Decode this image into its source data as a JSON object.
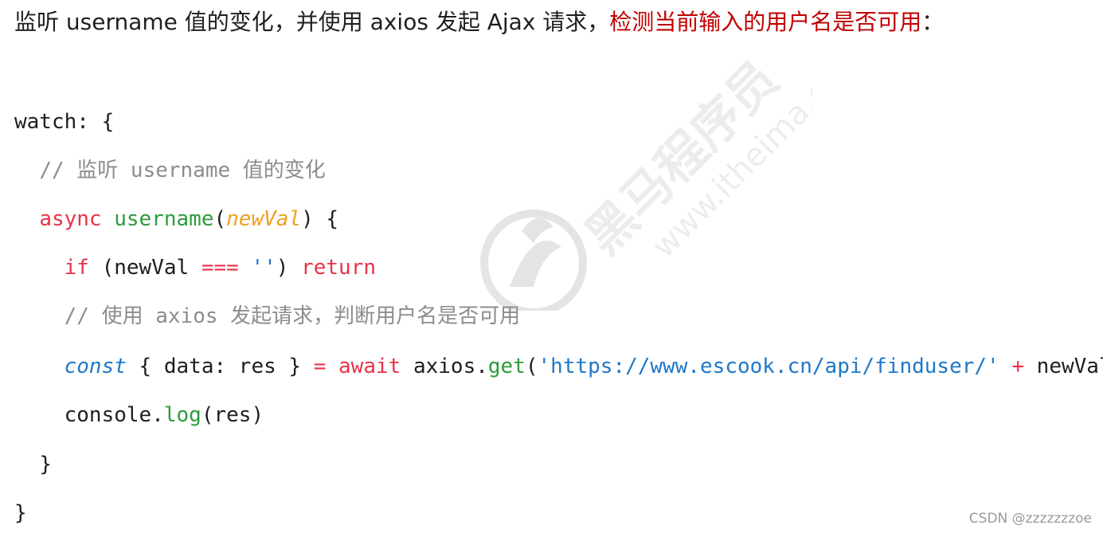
{
  "intro": {
    "normal": "监听 username 值的变化，并使用 axios 发起 Ajax 请求，",
    "highlight": "检测当前输入的用户名是否可用",
    "colon": "："
  },
  "code": {
    "l1": "watch: {",
    "l2_comment": "// 监听 username 值的变化",
    "l3_async": "async",
    "l3_fn": "username",
    "l3_open": "(",
    "l3_param": "newVal",
    "l3_close": ") {",
    "l4_if": "if",
    "l4_mid": " (newVal ",
    "l4_eq": "===",
    "l4_str": "''",
    "l4_paren": ") ",
    "l4_return": "return",
    "l5_comment": "// 使用 axios 发起请求，判断用户名是否可用",
    "l6_const": "const",
    "l6_mid": " { data: res } ",
    "l6_eq": "=",
    "l6_await": "await",
    "l6_axios": " axios.",
    "l6_get": "get",
    "l6_open": "(",
    "l6_str": "'https://www.escook.cn/api/finduser/'",
    "l6_plus": "+",
    "l6_tail": " newVal)",
    "l7_console": "console.",
    "l7_log": "log",
    "l7_tail": "(res)",
    "l8": "}",
    "l9": "}"
  },
  "watermark": {
    "brand": "黑马程序员",
    "url": "www.itheima.com"
  },
  "footer": {
    "credit": "CSDN @zzzzzzzoe"
  },
  "colors": {
    "highlight": "#c00000",
    "keyword": "#e8334a",
    "function": "#2c9b3c",
    "param": "#f0a020",
    "string": "#1e78c8",
    "comment": "#8c8c8c"
  }
}
